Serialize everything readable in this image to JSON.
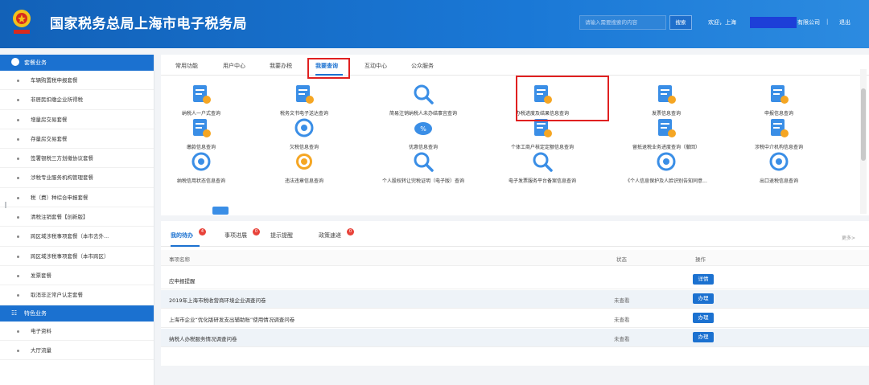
{
  "header": {
    "title": "国家税务总局上海市电子税务局",
    "search_placeholder": "请输入需要搜索的内容",
    "search_button": "搜索",
    "welcome": "欢迎，上海",
    "company_suffix": "有限公司",
    "separator": "|",
    "logout": "退出"
  },
  "sidebar": {
    "section1": "套餐业务",
    "items": [
      "车辆购置税申报套餐",
      "非居民扣缴企业所得税",
      "增量房交易套餐",
      "存量房交易套餐",
      "签署银税三方划缴协议套餐",
      "涉税专业服务机构管理套餐",
      "税（费）种综合申报套餐",
      "清税注销套餐【创新版】",
      "跨区域涉税事项套餐（本市去外...",
      "跨区域涉税事项套餐（本市跨区）",
      "发票套餐",
      "取消非正常户认定套餐"
    ],
    "section2": "特色业务",
    "items2": [
      "电子资料",
      "大厅流量"
    ]
  },
  "tabs": [
    "常用功能",
    "用户中心",
    "我要办税",
    "我要查询",
    "互动中心",
    "公众服务"
  ],
  "services": [
    {
      "label": "纳税人一户式查询",
      "icon": "taxpayer-query-icon"
    },
    {
      "label": "税务文书电子送达查询",
      "icon": "tax-document-icon"
    },
    {
      "label": "简易注销纳税人未办结事宜查询",
      "icon": "search-icon"
    },
    {
      "label": "办税进度及结果信息查询",
      "icon": "progress-query-icon"
    },
    {
      "label": "发票信息查询",
      "icon": "invoice-query-icon"
    },
    {
      "label": "申报信息查询",
      "icon": "declaration-query-icon"
    },
    {
      "label": "缴款信息查询",
      "icon": "payment-query-icon"
    },
    {
      "label": "欠税信息查询",
      "icon": "arrears-icon"
    },
    {
      "label": "优惠信息查询",
      "icon": "discount-icon"
    },
    {
      "label": "个体工商户核定定额信息查询",
      "icon": "business-quota-icon"
    },
    {
      "label": "留抵退税业务进度查询（撤回）",
      "icon": "refund-progress-icon"
    },
    {
      "label": "涉税中介机构信息查询",
      "icon": "tax-agency-icon"
    },
    {
      "label": "纳税信用状态信息查询",
      "icon": "credit-status-icon"
    },
    {
      "label": "违法违章信息查询",
      "icon": "violation-icon"
    },
    {
      "label": "个人股权转让完税证明（电子版）查询",
      "icon": "search-icon"
    },
    {
      "label": "电子发票服务平台备案信息查询",
      "icon": "search-icon"
    },
    {
      "label": "《个人信息保护及人脸识别告知同意...",
      "icon": "face-privacy-icon"
    },
    {
      "label": "出口退税信息查询",
      "icon": "export-refund-icon"
    }
  ],
  "todo": {
    "tabs": [
      {
        "label": "我的待办",
        "badge": "4"
      },
      {
        "label": "事项进展",
        "badge": "0"
      },
      {
        "label": "提示提醒",
        "badge": ""
      },
      {
        "label": "政策速递",
        "badge": "0"
      }
    ],
    "more": "更多>",
    "headers": [
      "事项名称",
      "状态",
      "操作"
    ],
    "rows": [
      {
        "name": "应申报提醒",
        "status": "",
        "action": "详情"
      },
      {
        "name": "2019年上海市税收营商环境企业调查问卷",
        "status": "未查看",
        "action": "办理"
      },
      {
        "name": "上海市企业“优化版研发支出辅助账”使用情况调查问卷",
        "status": "未查看",
        "action": "办理"
      },
      {
        "name": "纳税人办税服务情况调查问卷",
        "status": "未查看",
        "action": "办理"
      }
    ]
  },
  "colors": {
    "primary": "#1b71d0",
    "highlight": "#e02020",
    "header_bg": "#1261b8"
  }
}
